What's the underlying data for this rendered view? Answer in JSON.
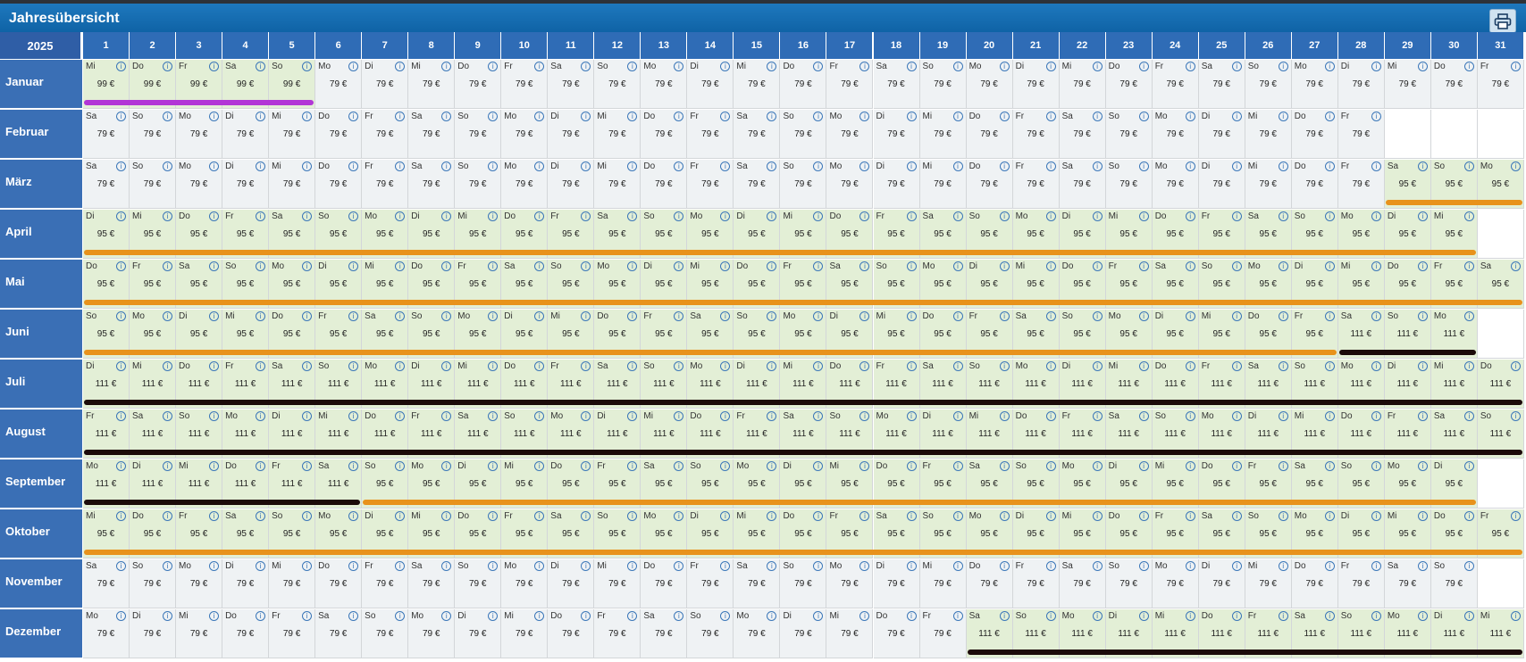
{
  "title": "Jahresübersicht",
  "year": "2025",
  "print_icon": "printer-icon",
  "colors": {
    "header": "#0f63a6",
    "plain": "#eff2f4",
    "green": "#e3efd6",
    "purple": "#b236d6",
    "orange": "#e8921c",
    "dark": "#1c0a0a"
  },
  "days": [
    "1",
    "2",
    "3",
    "4",
    "5",
    "6",
    "7",
    "8",
    "9",
    "10",
    "11",
    "12",
    "13",
    "14",
    "15",
    "16",
    "17",
    "18",
    "19",
    "20",
    "21",
    "22",
    "23",
    "24",
    "25",
    "26",
    "27",
    "28",
    "29",
    "30",
    "31"
  ],
  "months": [
    {
      "name": "Januar",
      "start": 2,
      "len": 31,
      "segments": [
        [
          1,
          5,
          "99 €"
        ],
        [
          6,
          31,
          "79 €"
        ]
      ],
      "green": [
        [
          1,
          5
        ]
      ],
      "bars": [
        [
          1,
          5,
          "purple"
        ]
      ]
    },
    {
      "name": "Februar",
      "start": 5,
      "len": 28,
      "segments": [
        [
          1,
          28,
          "79 €"
        ]
      ],
      "green": [],
      "bars": []
    },
    {
      "name": "März",
      "start": 5,
      "len": 31,
      "segments": [
        [
          1,
          28,
          "79 €"
        ],
        [
          29,
          31,
          "95 €"
        ]
      ],
      "green": [
        [
          29,
          31
        ]
      ],
      "bars": [
        [
          29,
          31,
          "orange"
        ]
      ]
    },
    {
      "name": "April",
      "start": 1,
      "len": 30,
      "segments": [
        [
          1,
          30,
          "95 €"
        ]
      ],
      "green": [
        [
          1,
          30
        ]
      ],
      "bars": [
        [
          1,
          30,
          "orange"
        ]
      ]
    },
    {
      "name": "Mai",
      "start": 3,
      "len": 31,
      "segments": [
        [
          1,
          31,
          "95 €"
        ]
      ],
      "green": [
        [
          1,
          31
        ]
      ],
      "bars": [
        [
          1,
          31,
          "orange"
        ]
      ]
    },
    {
      "name": "Juni",
      "start": 6,
      "len": 30,
      "segments": [
        [
          1,
          27,
          "95 €"
        ],
        [
          28,
          30,
          "111 €"
        ]
      ],
      "green": [
        [
          1,
          30
        ]
      ],
      "bars": [
        [
          1,
          27,
          "orange"
        ],
        [
          28,
          30,
          "dark"
        ]
      ]
    },
    {
      "name": "Juli",
      "start": 1,
      "len": 31,
      "segments": [
        [
          1,
          31,
          "111 €"
        ]
      ],
      "green": [
        [
          1,
          31
        ]
      ],
      "bars": [
        [
          1,
          31,
          "dark"
        ]
      ]
    },
    {
      "name": "August",
      "start": 4,
      "len": 31,
      "segments": [
        [
          1,
          31,
          "111 €"
        ]
      ],
      "green": [
        [
          1,
          31
        ]
      ],
      "bars": [
        [
          1,
          31,
          "dark"
        ]
      ]
    },
    {
      "name": "September",
      "start": 0,
      "len": 30,
      "segments": [
        [
          1,
          6,
          "111 €"
        ],
        [
          7,
          30,
          "95 €"
        ]
      ],
      "green": [
        [
          1,
          30
        ]
      ],
      "bars": [
        [
          1,
          6,
          "dark"
        ],
        [
          7,
          30,
          "orange"
        ]
      ]
    },
    {
      "name": "Oktober",
      "start": 2,
      "len": 31,
      "segments": [
        [
          1,
          31,
          "95 €"
        ]
      ],
      "green": [
        [
          1,
          31
        ]
      ],
      "bars": [
        [
          1,
          31,
          "orange"
        ]
      ]
    },
    {
      "name": "November",
      "start": 5,
      "len": 30,
      "segments": [
        [
          1,
          30,
          "79 €"
        ]
      ],
      "green": [],
      "bars": []
    },
    {
      "name": "Dezember",
      "start": 0,
      "len": 31,
      "segments": [
        [
          1,
          19,
          "79 €"
        ],
        [
          20,
          31,
          "111 €"
        ]
      ],
      "green": [
        [
          20,
          31
        ]
      ],
      "bars": [
        [
          20,
          31,
          "dark"
        ]
      ]
    }
  ],
  "weekdays": [
    "Mo",
    "Di",
    "Mi",
    "Do",
    "Fr",
    "Sa",
    "So"
  ]
}
